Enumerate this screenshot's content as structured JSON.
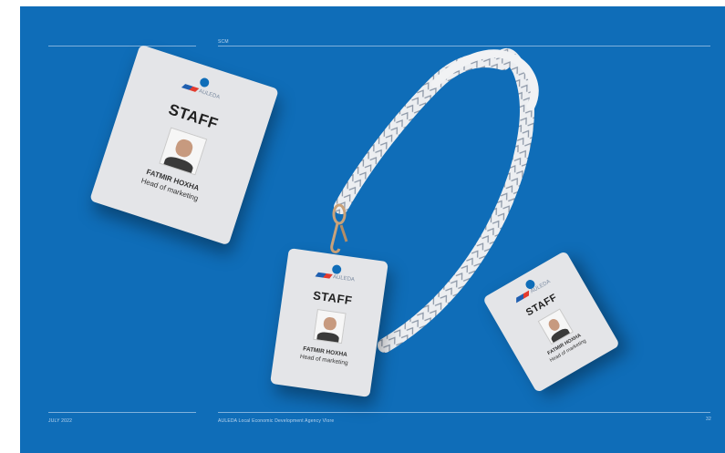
{
  "header": {
    "section": "SCM"
  },
  "footer": {
    "date": "JULY 2022",
    "agency": "AULEDA Local Economic Development Agency Vlore",
    "page_number": "32"
  },
  "badges": [
    {
      "logo": "AULEDA",
      "title": "STAFF",
      "name": "FATMIR HOXHA",
      "role": "Head of marketing"
    },
    {
      "logo": "AULEDA",
      "title": "STAFF",
      "name": "FATMIR HOXHA",
      "role": "Head of marketing"
    },
    {
      "logo": "AULEDA",
      "title": "STAFF",
      "name": "FATMIR HOXHA",
      "role": "Head of marketing"
    }
  ],
  "colors": {
    "background": "#0f6db8",
    "card": "#e4e5e8",
    "lanyard": "#eceef1"
  }
}
